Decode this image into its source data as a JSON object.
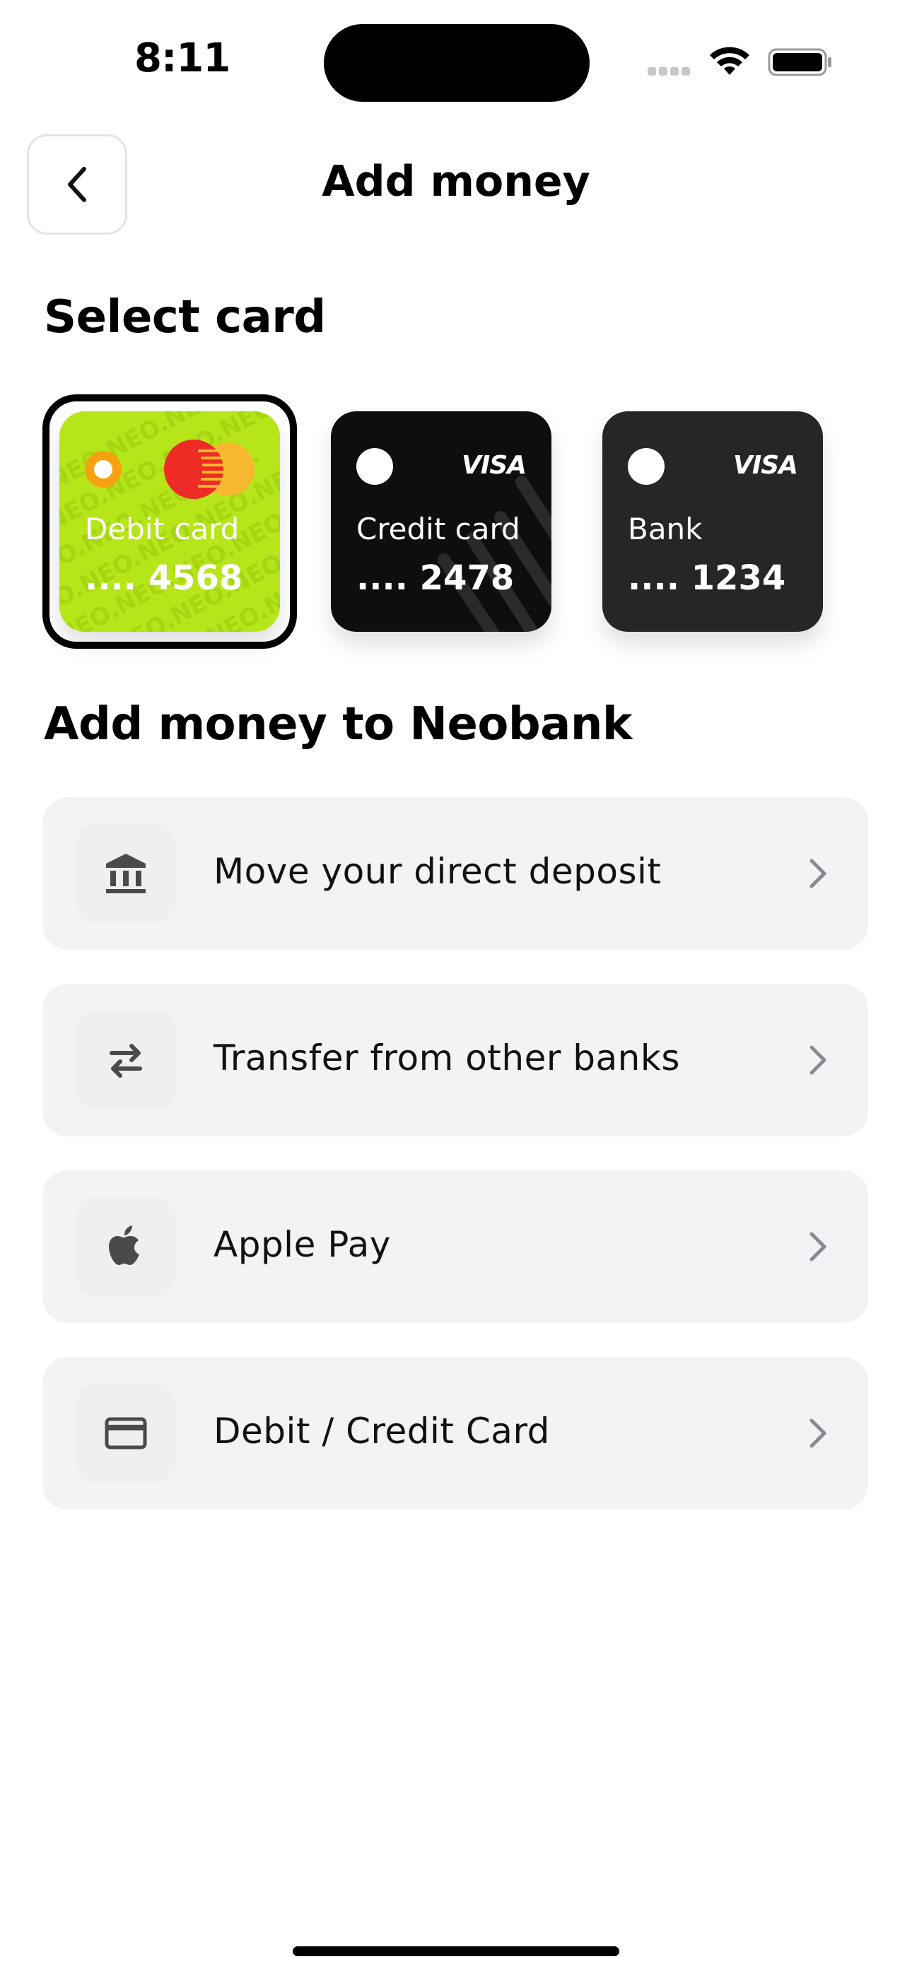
{
  "status_bar": {
    "time": "8:11"
  },
  "header": {
    "title": "Add money"
  },
  "select_card": {
    "title": "Select card",
    "cards": [
      {
        "label": "Debit card",
        "number": ".... 4568",
        "brand": "mastercard",
        "color": "#b6e61a",
        "pattern_text": "NEO.",
        "selected": true
      },
      {
        "label": "Credit card",
        "number": ".... 2478",
        "brand": "VISA",
        "color": "#0e0e0e",
        "selected": false
      },
      {
        "label": "Bank",
        "number": ".... 1234",
        "brand": "VISA",
        "color": "#262626",
        "selected": false
      }
    ]
  },
  "add_money": {
    "title": "Add money to Neobank",
    "options": [
      {
        "label": "Move your direct deposit",
        "icon": "bank-icon"
      },
      {
        "label": "Transfer from other banks",
        "icon": "transfer-arrows-icon"
      },
      {
        "label": "Apple Pay",
        "icon": "apple-icon"
      },
      {
        "label": "Debit / Credit Card",
        "icon": "credit-card-icon"
      }
    ]
  }
}
